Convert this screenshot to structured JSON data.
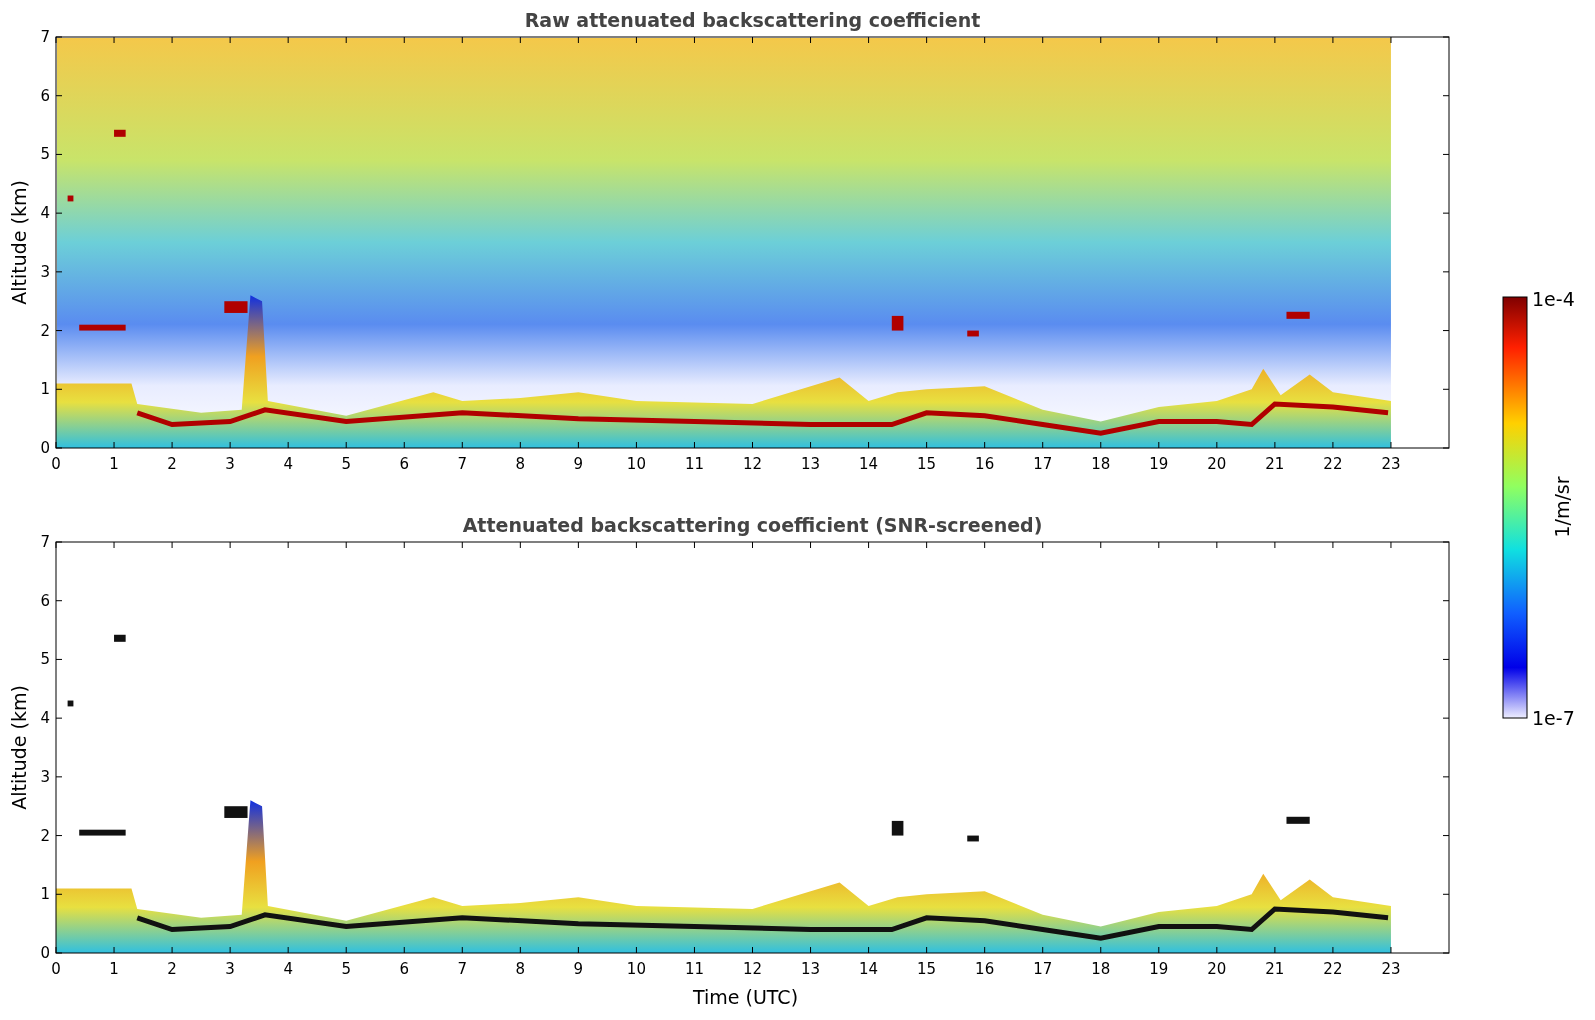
{
  "panels": [
    {
      "kind": "raw",
      "title": "Raw attenuated backscattering coefficient",
      "ylabel": "Altitude (km)",
      "yticks": [
        "7",
        "6",
        "5",
        "4",
        "3",
        "2",
        "1",
        "0"
      ],
      "xticks": [
        "0",
        "1",
        "2",
        "3",
        "4",
        "5",
        "6",
        "7",
        "8",
        "9",
        "10",
        "11",
        "12",
        "13",
        "14",
        "15",
        "16",
        "17",
        "18",
        "19",
        "20",
        "21",
        "22",
        "23"
      ]
    },
    {
      "kind": "screened",
      "title": "Attenuated backscattering coefficient (SNR-screened)",
      "ylabel": "Altitude (km)",
      "xlabel": "Time (UTC)",
      "yticks": [
        "7",
        "6",
        "5",
        "4",
        "3",
        "2",
        "1",
        "0"
      ],
      "xticks": [
        "0",
        "1",
        "2",
        "3",
        "4",
        "5",
        "6",
        "7",
        "8",
        "9",
        "10",
        "11",
        "12",
        "13",
        "14",
        "15",
        "16",
        "17",
        "18",
        "19",
        "20",
        "21",
        "22",
        "23"
      ]
    }
  ],
  "colorbar": {
    "max_label": "1e-4",
    "min_label": "1e-7",
    "label": "1/m/sr"
  }
}
